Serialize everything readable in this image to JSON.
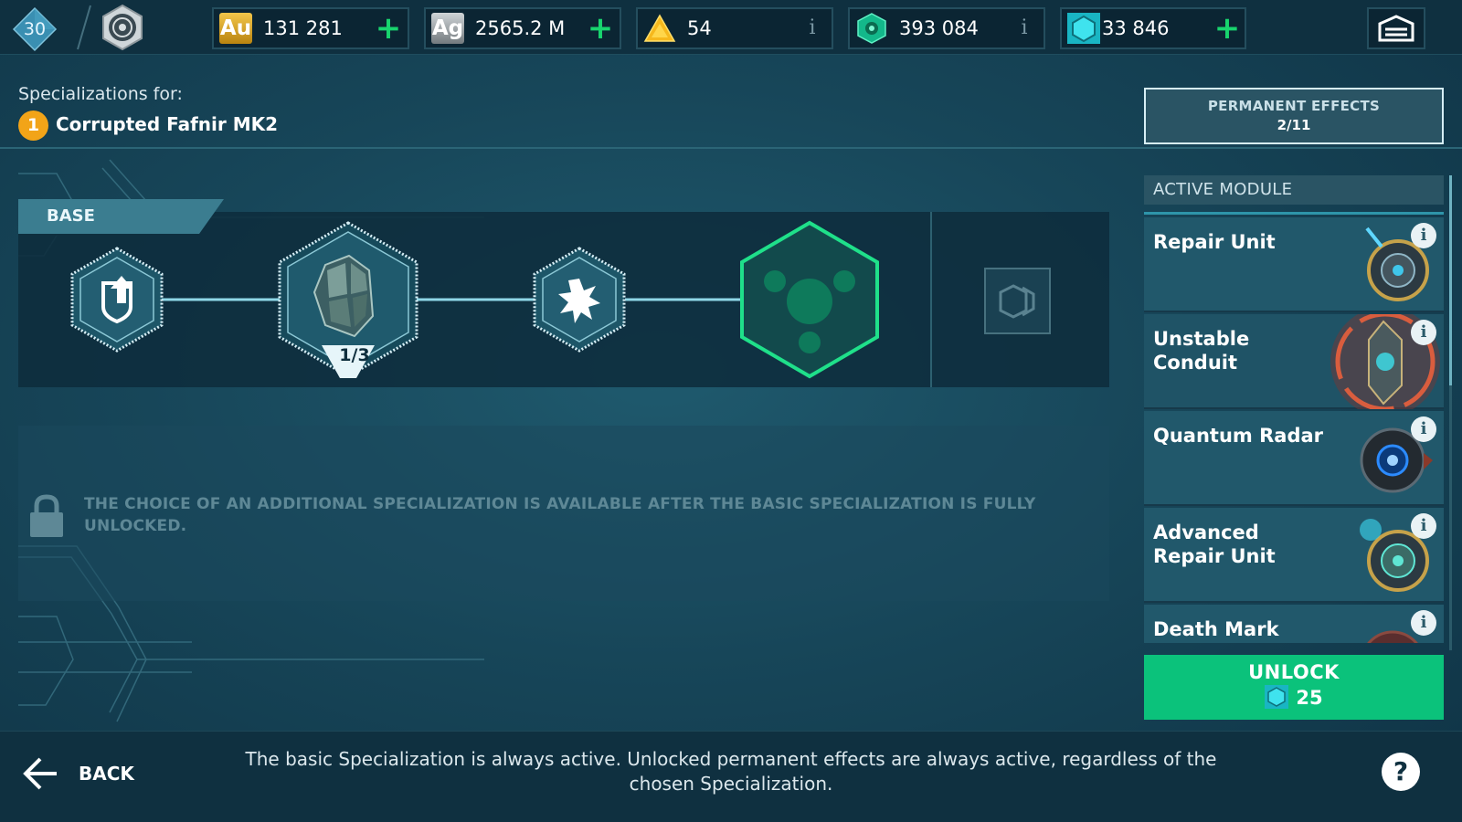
{
  "topbar": {
    "level": "30",
    "resources": [
      {
        "id": "gold",
        "symbol": "Au",
        "value": "131 281",
        "action": "plus"
      },
      {
        "id": "silver",
        "symbol": "Ag",
        "value": "2565.2 M",
        "action": "plus"
      },
      {
        "id": "triangle-token",
        "value": "54",
        "action": "info"
      },
      {
        "id": "green-token",
        "value": "393 084",
        "action": "info"
      },
      {
        "id": "hex-crystal",
        "value": "33 846",
        "action": "plus"
      }
    ],
    "plus_symbol": "+",
    "info_symbol": "i"
  },
  "header": {
    "spec_for_label": "Specializations for:",
    "ship_badge_number": "1",
    "ship_name": "Corrupted Fafnir MK2"
  },
  "permanent_effects": {
    "label": "PERMANENT EFFECTS",
    "count": "2/11"
  },
  "tree": {
    "base_label": "BASE",
    "armor_counter": "1/3"
  },
  "locked_message": "THE CHOICE OF AN ADDITIONAL SPECIALIZATION IS AVAILABLE AFTER THE BASIC SPECIALIZATION IS FULLY UNLOCKED.",
  "active_module": {
    "header": "ACTIVE MODULE",
    "info_symbol": "i",
    "modules": [
      {
        "name": "Repair Unit"
      },
      {
        "name": "Unstable Conduit"
      },
      {
        "name": "Quantum Radar"
      },
      {
        "name": "Advanced Repair Unit"
      },
      {
        "name": "Death Mark"
      }
    ]
  },
  "unlock": {
    "label": "UNLOCK",
    "cost": "25"
  },
  "footer": {
    "back_label": "BACK",
    "text": "The basic Specialization is always active. Unlocked permanent effects are always active, regardless of the chosen Specialization.",
    "help_symbol": "?"
  },
  "colors": {
    "background": "#174659",
    "bar": "#0f3040",
    "accent_green": "#0bc27b",
    "plus_green": "#18d46e",
    "selected_node": "#1fe08a",
    "badge_orange": "#f2a418"
  },
  "icons": [
    "level-diamond-icon",
    "emblem-icon",
    "gold-icon",
    "silver-icon",
    "triangle-token-icon",
    "green-token-icon",
    "hex-crystal-icon",
    "garage-icon",
    "lock-icon",
    "back-arrow-icon",
    "help-icon"
  ]
}
